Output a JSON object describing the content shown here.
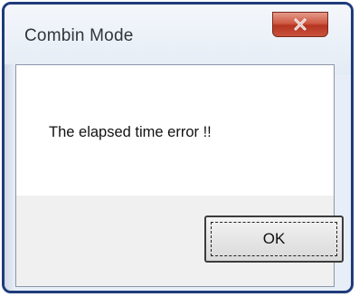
{
  "window": {
    "title": "Combin Mode",
    "close_icon": "close-icon"
  },
  "dialog": {
    "message": "The elapsed time error !!",
    "ok_label": "OK"
  },
  "colors": {
    "frame_border": "#1f3b7a",
    "close_button": "#c9523d",
    "button_area": "#f0f0f0"
  }
}
